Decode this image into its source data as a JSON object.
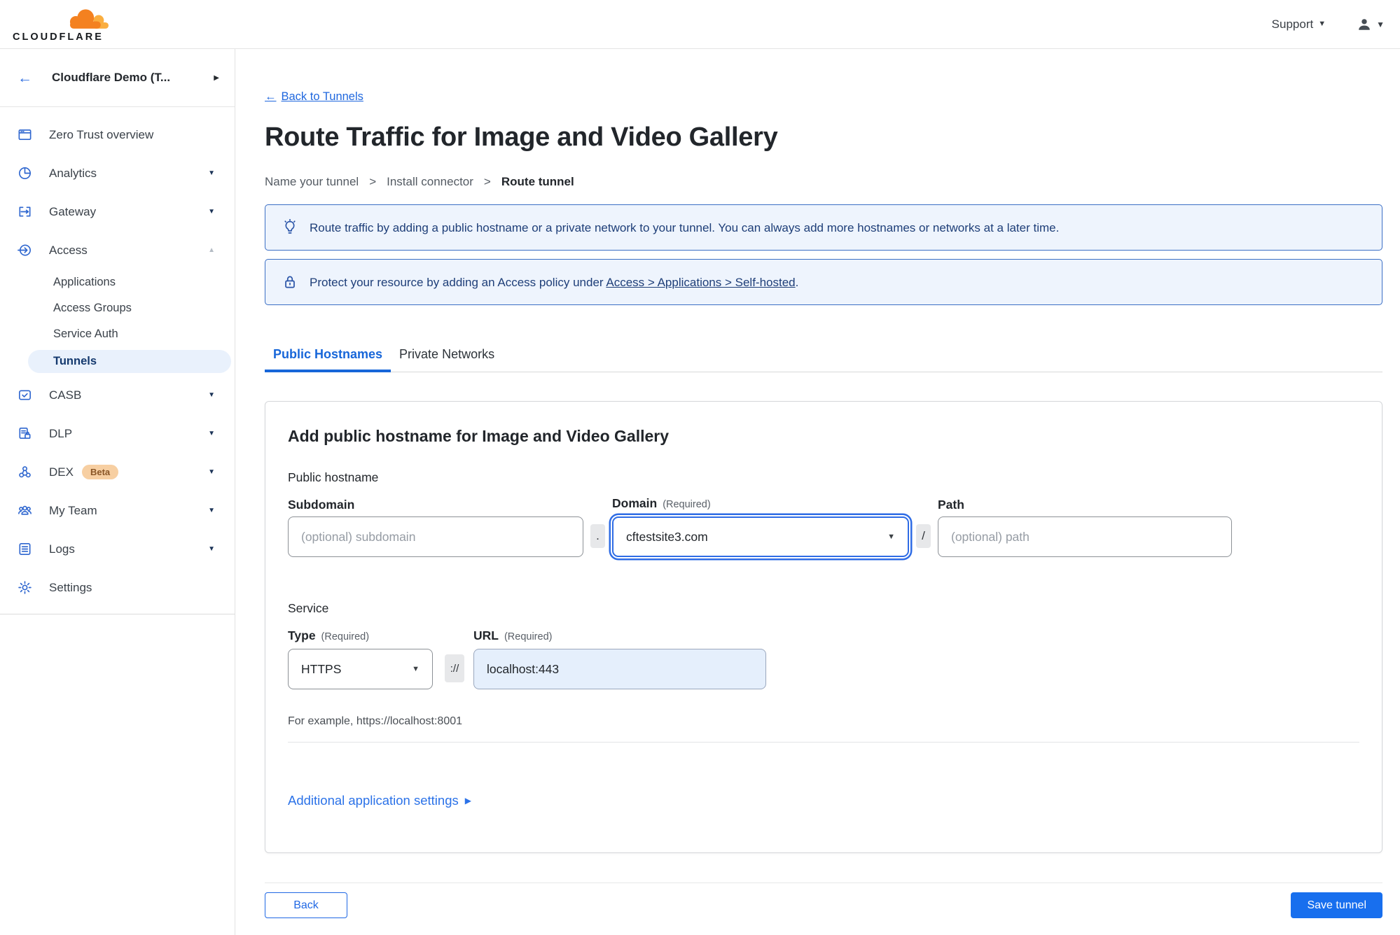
{
  "colors": {
    "accent_blue": "#186fee",
    "link_blue": "#1f67de",
    "active_tab_blue": "#1766d9",
    "banner_bg": "#eef4fd",
    "banner_border": "#3b6fc5",
    "banner_text": "#1e3e78",
    "selected_pill_bg": "#e9f1fc",
    "logo_orange": "#f48120",
    "logo_orange_light": "#faae40",
    "beta_badge_bg": "#f7cfa2",
    "url_field_bg": "#e5effc"
  },
  "glyphs": {
    "back_arrow": "←",
    "chevron_right": "▶",
    "caret_down": "▼",
    "caret_up": "▲",
    "link_arrow": "▶"
  },
  "header": {
    "logo_text": "CLOUDFLARE",
    "support_label": "Support"
  },
  "sidebar": {
    "team_name": "Cloudflare Demo (T...",
    "items": [
      {
        "label": "Zero Trust overview"
      },
      {
        "label": "Analytics"
      },
      {
        "label": "Gateway"
      },
      {
        "label": "Access"
      },
      {
        "label": "CASB"
      },
      {
        "label": "DLP"
      },
      {
        "label": "DEX",
        "badge": "Beta"
      },
      {
        "label": "My Team"
      },
      {
        "label": "Logs"
      },
      {
        "label": "Settings"
      }
    ],
    "access_children": [
      {
        "label": "Applications"
      },
      {
        "label": "Access Groups"
      },
      {
        "label": "Service Auth"
      },
      {
        "label": "Tunnels",
        "selected": true
      }
    ]
  },
  "main": {
    "back_link_label": "Back to Tunnels",
    "title": "Route Traffic for Image and Video Gallery",
    "step_separator": ">",
    "steps": [
      {
        "label": "Name your tunnel"
      },
      {
        "label": "Install connector"
      },
      {
        "label": "Route tunnel",
        "current": true
      }
    ],
    "banners": [
      {
        "icon": "lightbulb-icon",
        "text": "Route traffic by adding a public hostname or a private network to your tunnel. You can always add more hostnames or networks at a later time."
      },
      {
        "icon": "lock-icon",
        "text_before": "Protect your resource by adding an Access policy under ",
        "link": "Access > Applications > Self-hosted",
        "text_after": "."
      }
    ],
    "tabs": [
      {
        "label": "Public Hostnames",
        "active": true
      },
      {
        "label": "Private Networks"
      }
    ],
    "card": {
      "heading": "Add public hostname for Image and Video Gallery",
      "public_hostname_label": "Public hostname",
      "subdomain": {
        "label": "Subdomain",
        "placeholder": "(optional) subdomain"
      },
      "domain": {
        "label": "Domain",
        "required_note": "(Required)",
        "value": "cftestsite3.com"
      },
      "path": {
        "label": "Path",
        "placeholder": "(optional) path"
      },
      "separators": {
        "dot": ".",
        "slash": "/",
        "scheme": "://"
      },
      "service_label": "Service",
      "type": {
        "label": "Type",
        "required_note": "(Required)",
        "value": "HTTPS"
      },
      "url": {
        "label": "URL",
        "required_note": "(Required)",
        "value": "localhost:443"
      },
      "example_text": "For example, https://localhost:8001",
      "additional_settings_label": "Additional application settings"
    },
    "footer": {
      "back_label": "Back",
      "save_label": "Save tunnel"
    }
  }
}
